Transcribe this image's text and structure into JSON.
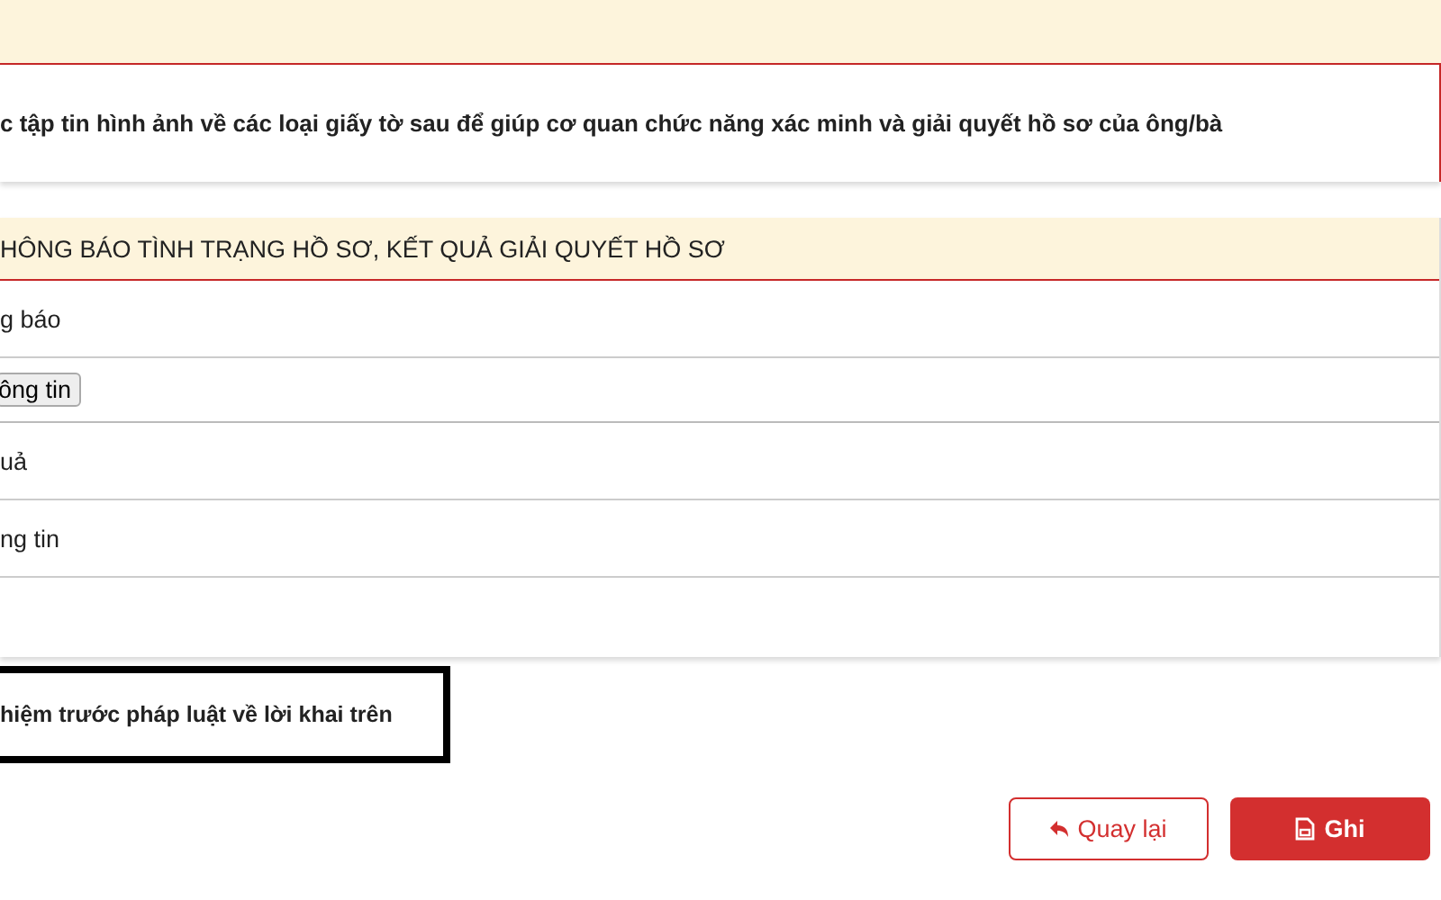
{
  "instruction": "c tập tin hình ảnh về các loại giấy tờ sau để giúp cơ quan chức năng xác minh và giải quyết hồ sơ của ông/bà",
  "section": {
    "title": "HÔNG BÁO TÌNH TRẠNG HỒ SƠ, KẾT QUẢ GIẢI QUYẾT HỒ SƠ",
    "rows": [
      {
        "kind": "label",
        "text": "g báo"
      },
      {
        "kind": "button",
        "text": "ông tin"
      },
      {
        "kind": "label",
        "text": "uả"
      },
      {
        "kind": "label",
        "text": "ng tin"
      },
      {
        "kind": "empty"
      }
    ]
  },
  "commitment": "hiệm trước pháp luật về lời khai trên",
  "buttons": [
    {
      "kind": "back",
      "label": "Quay lại"
    },
    {
      "kind": "save",
      "label": "Ghi"
    }
  ]
}
